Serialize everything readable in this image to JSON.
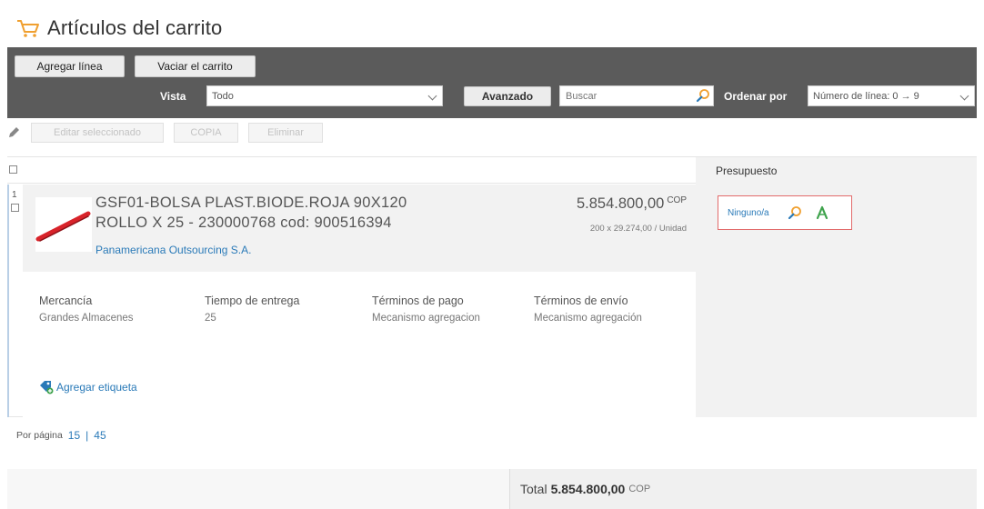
{
  "header": {
    "title": "Artículos del carrito",
    "icon": "cart-icon"
  },
  "toolbar": {
    "add_line": "Agregar línea",
    "empty_cart": "Vaciar el carrito",
    "vista_label": "Vista",
    "vista_value": "Todo",
    "advanced": "Avanzado",
    "search_placeholder": "Buscar",
    "sort_label": "Ordenar por",
    "sort_value": "Número de línea: 0 → 9"
  },
  "actions": {
    "edit_selected": "Editar seleccionado",
    "copy": "COPIA",
    "delete": "Eliminar"
  },
  "table": {
    "budget_header": "Presupuesto"
  },
  "item": {
    "line_number": "1",
    "title_line1": "GSF01-BOLSA PLAST.BIODE.ROJA 90X120",
    "title_line2": "ROLLO X 25 - 230000768 cod: 900516394",
    "supplier": "Panamericana Outsourcing S.A.",
    "price": "5.854.800,00",
    "price_currency": "COP",
    "unit_detail": "200 x 29.274,00 / Unidad",
    "details": [
      {
        "label": "Mercancía",
        "value": "Grandes Almacenes"
      },
      {
        "label": "Tiempo de entrega",
        "value": "25"
      },
      {
        "label": "Términos de pago",
        "value": "Mecanismo agregacion"
      },
      {
        "label": "Términos de envío",
        "value": "Mecanismo agregación"
      }
    ],
    "add_tag": "Agregar etiqueta",
    "budget_value": "Ninguno/a"
  },
  "pager": {
    "label": "Por página",
    "options": [
      "15",
      "45"
    ],
    "separator": "|"
  },
  "footer": {
    "total_label": "Total",
    "total_amount": "5.854.800,00",
    "total_currency": "COP"
  },
  "colors": {
    "toolbar_bg": "#5b5b5b",
    "link": "#2a7ab8",
    "budget_border": "#e26b6b",
    "accent_orange": "#f0a030"
  }
}
